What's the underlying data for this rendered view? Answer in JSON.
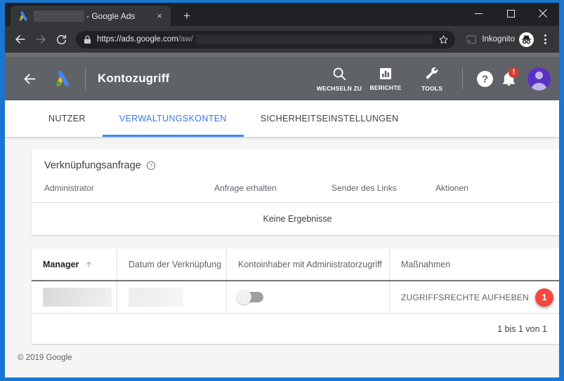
{
  "browser": {
    "tab": {
      "title": "- Google Ads",
      "favicon": "google-ads-favicon",
      "close": "×",
      "redacted_account": ""
    },
    "new_tab": "+",
    "window_controls": {
      "minimize": "minimize",
      "maximize": "maximize",
      "close": "close"
    },
    "nav": {
      "back": "back-arrow",
      "forward": "forward-arrow",
      "reload": "reload"
    },
    "omnibox": {
      "lock": "lock-icon",
      "url_secure": "https://ads.google.com",
      "url_path": "/aw/",
      "star": "bookmark-star"
    },
    "cast": "cast-icon",
    "profile_label": "Inkognito",
    "menu": "three-dot-menu"
  },
  "appbar": {
    "back": "back-arrow",
    "logo": "google-ads-logo",
    "title": "Kontozugriff",
    "tools": [
      {
        "icon": "search-icon",
        "label": "WECHSELN ZU"
      },
      {
        "icon": "bar-chart-icon",
        "label": "BERICHTE"
      },
      {
        "icon": "wrench-icon",
        "label": "TOOLS"
      }
    ],
    "help": "help-icon",
    "notifications": {
      "icon": "bell-icon",
      "badge": "!"
    },
    "avatar": "user-avatar"
  },
  "tabs": [
    {
      "label": "NUTZER",
      "active": false
    },
    {
      "label": "VERWALTUNGSKONTEN",
      "active": true
    },
    {
      "label": "SICHERHEITSEINSTELLUNGEN",
      "active": false
    }
  ],
  "link_request_card": {
    "title": "Verknüpfungsanfrage",
    "help_icon": "help-circle-icon",
    "columns": [
      "Administrator",
      "Anfrage erhalten",
      "Sender des Links",
      "Aktionen"
    ],
    "empty_message": "Keine Ergebnisse"
  },
  "manager_table": {
    "columns": [
      {
        "label": "Manager",
        "sorted": true,
        "sort_icon": "arrow-up-icon"
      },
      {
        "label": "Datum der Verknüpfung",
        "sorted": false
      },
      {
        "label": "Kontoinhaber mit Administratorzugriff",
        "sorted": false
      },
      {
        "label": "Maßnahmen",
        "sorted": false
      }
    ],
    "rows": [
      {
        "manager": "",
        "date": "",
        "admin_access_toggle": "off",
        "action_label": "ZUGRIFFSRECHTE AUFHEBEN",
        "step_badge": "1"
      }
    ],
    "footer": "1 bis 1 von 1"
  },
  "footer": {
    "copyright": "© 2019 Google"
  },
  "colors": {
    "accent_blue": "#4285f4",
    "appbar_gray": "#5f6368",
    "badge_red": "#f4473f",
    "window_border_blue": "#1976d2",
    "page_bg": "#f5f5f5"
  }
}
